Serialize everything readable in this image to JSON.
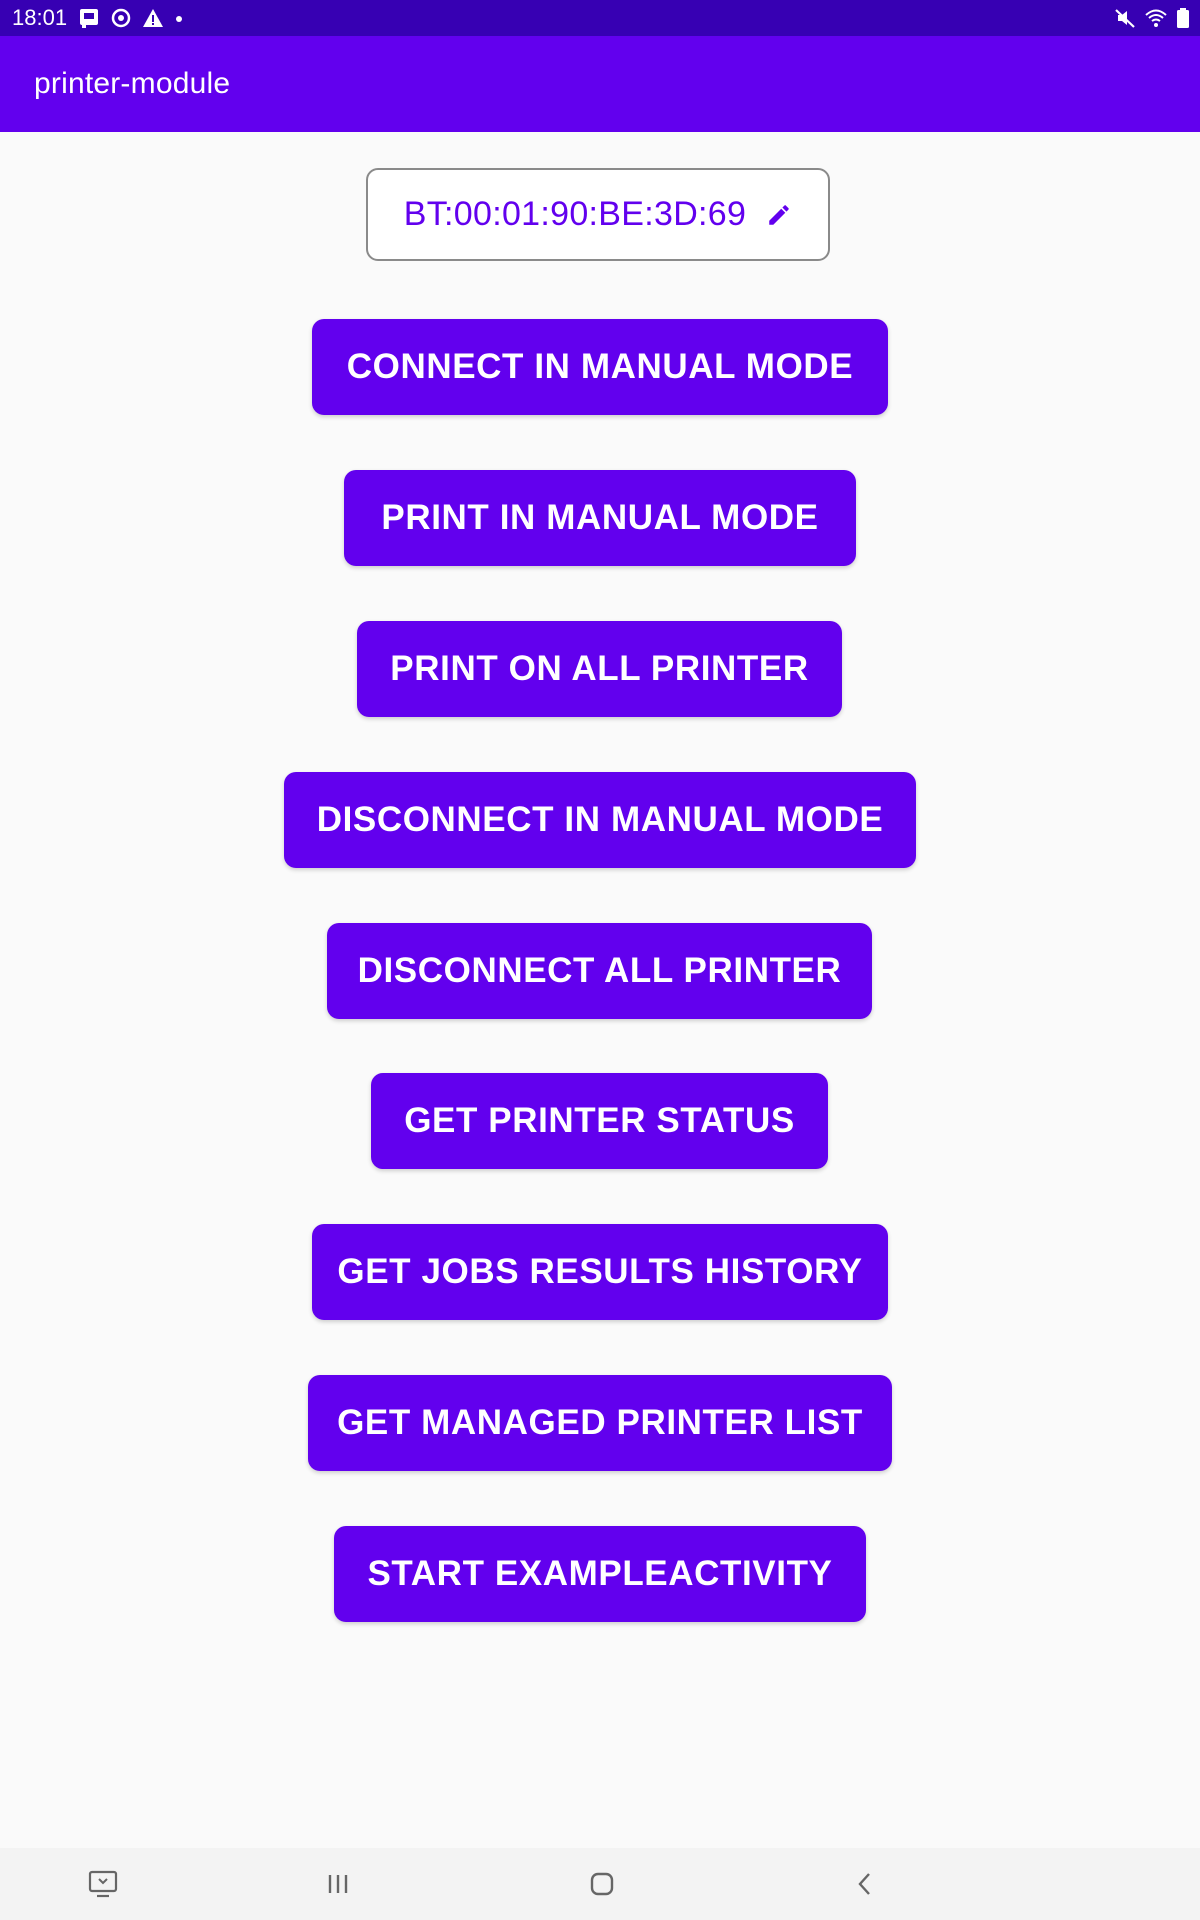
{
  "status_bar": {
    "time": "18:01",
    "left_icons": [
      "screenshot-icon",
      "sync-icon",
      "warning-icon",
      "dot-icon"
    ],
    "right_icons": [
      "mute-icon",
      "wifi-icon",
      "battery-icon"
    ],
    "background": "#3700b3"
  },
  "app_bar": {
    "title": "printer-module",
    "background": "#6200ee"
  },
  "main": {
    "printer_address": "BT:00:01:90:BE:3D:69",
    "edit_icon": "edit-icon",
    "buttons": [
      {
        "label": "CONNECT IN MANUAL MODE"
      },
      {
        "label": "PRINT IN MANUAL MODE"
      },
      {
        "label": "PRINT ON ALL PRINTER"
      },
      {
        "label": "DISCONNECT IN MANUAL MODE"
      },
      {
        "label": "DISCONNECT ALL PRINTER"
      },
      {
        "label": "GET PRINTER STATUS"
      },
      {
        "label": "GET JOBS RESULTS HISTORY"
      },
      {
        "label": "GET MANAGED PRINTER LIST"
      },
      {
        "label": "START EXAMPLEACTIVITY"
      }
    ],
    "accent": "#6200ee"
  },
  "nav_bar": {
    "items": [
      "screen-icon",
      "recents-icon",
      "home-icon",
      "back-icon"
    ]
  }
}
